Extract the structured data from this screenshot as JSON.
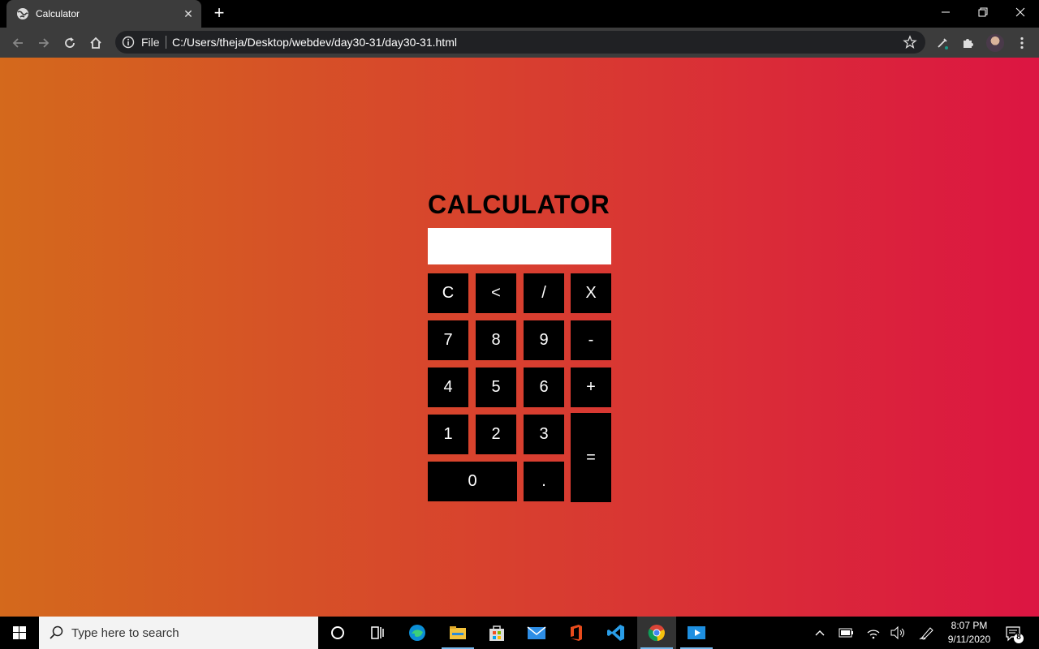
{
  "browser": {
    "tab_title": "Calculator",
    "omnibox_scheme": "File",
    "url": "C:/Users/theja/Desktop/webdev/day30-31/day30-31.html"
  },
  "calculator": {
    "title": "CALCULATOR",
    "display_value": "",
    "keys": [
      {
        "label": "C"
      },
      {
        "label": "<"
      },
      {
        "label": "/"
      },
      {
        "label": "X"
      },
      {
        "label": "7"
      },
      {
        "label": "8"
      },
      {
        "label": "9"
      },
      {
        "label": "-"
      },
      {
        "label": "4"
      },
      {
        "label": "5"
      },
      {
        "label": "6"
      },
      {
        "label": "+"
      },
      {
        "label": "1"
      },
      {
        "label": "2"
      },
      {
        "label": "3"
      },
      {
        "label": "="
      },
      {
        "label": "0"
      },
      {
        "label": "."
      }
    ],
    "colors": {
      "key_bg": "#000000",
      "key_text": "#ffffff",
      "gradient_start": "#d4691c",
      "gradient_end": "#dc1542"
    }
  },
  "taskbar": {
    "search_placeholder": "Type here to search",
    "time": "8:07 PM",
    "date": "9/11/2020",
    "notification_count": "8",
    "pinned_apps": [
      "cortana-icon",
      "task-view-icon",
      "edge-icon",
      "file-explorer-icon",
      "store-icon",
      "mail-icon",
      "office-icon",
      "vscode-icon",
      "chrome-icon",
      "media-player-icon"
    ]
  }
}
